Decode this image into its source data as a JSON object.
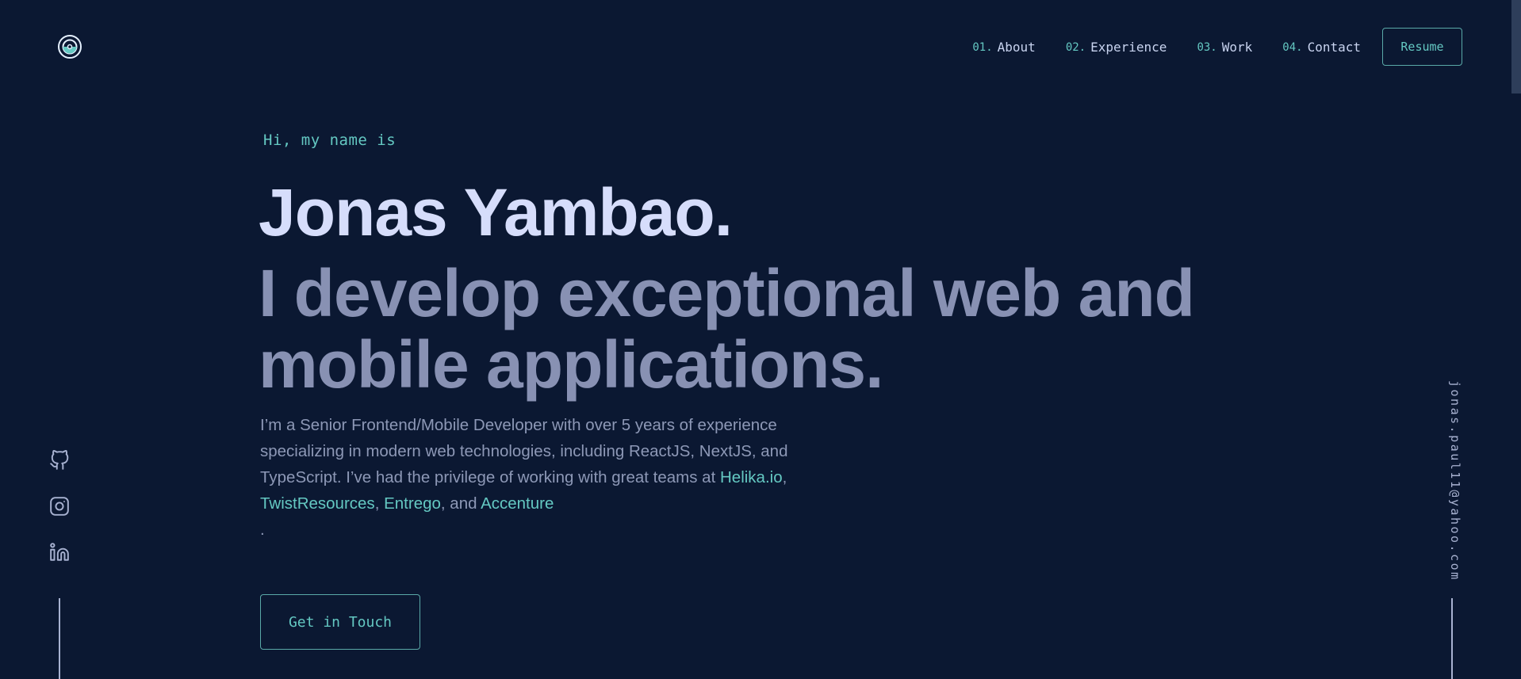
{
  "brand": {
    "logo_icon": "logo-icon"
  },
  "nav": {
    "items": [
      {
        "num": "01.",
        "label": "About"
      },
      {
        "num": "02.",
        "label": "Experience"
      },
      {
        "num": "03.",
        "label": "Work"
      },
      {
        "num": "04.",
        "label": "Contact"
      }
    ],
    "resume_label": "Resume"
  },
  "hero": {
    "greeting": "Hi, my name is",
    "name": "Jonas Yambao.",
    "tagline": "I develop exceptional web and mobile applications.",
    "bio_intro": "I’m a Senior Frontend/Mobile Developer with over 5 years of experience specializing in modern web technologies, including ReactJS, NextJS, and TypeScript. I’ve had the privilege of working with great teams at ",
    "companies": [
      "Helika.io",
      "TwistResources",
      "Entrego",
      "Accenture"
    ],
    "sep_comma": ", ",
    "sep_comma_and": ", and ",
    "bio_end": ".",
    "cta_label": "Get in Touch"
  },
  "social": {
    "icons": [
      "github-icon",
      "instagram-icon",
      "linkedin-icon"
    ]
  },
  "email": "jonas.paul11@yahoo.com",
  "colors": {
    "background": "#0b1832",
    "accent": "#64c8c2",
    "heading": "#d6ddfb",
    "subheading": "#8891b3",
    "body_text": "#8d98b6"
  }
}
